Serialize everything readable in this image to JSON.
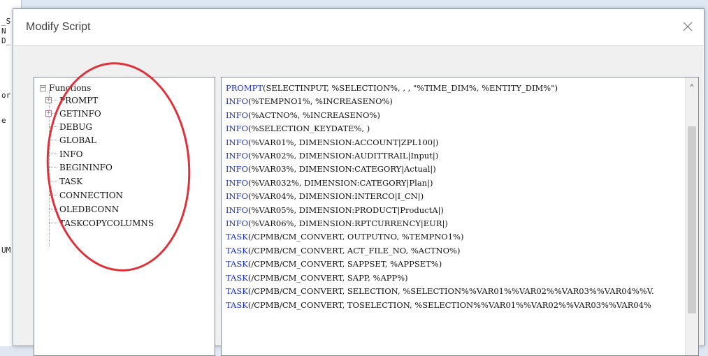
{
  "background": {
    "fragments": [
      "_S",
      "N",
      "D_",
      "or",
      "e",
      "UM"
    ]
  },
  "dialog": {
    "title": "Modify Script",
    "close_glyph": "×"
  },
  "tree": {
    "root_label": "Functions",
    "root_expander": "−",
    "child_expander": "+",
    "items": [
      "PROMPT",
      "GETINFO",
      "DEBUG",
      "GLOBAL",
      "INFO",
      "BEGININFO",
      "TASK",
      "CONNECTION",
      "OLEDBCONN",
      "TASKCOPYCOLUMNS"
    ]
  },
  "script": {
    "lines": [
      {
        "cmd": "PROMPT",
        "args": "(SELECTINPUT, %SELECTION%, , , \"%TIME_DIM%, %ENTITY_DIM%\")"
      },
      {
        "cmd": "INFO",
        "args": "(%TEMPNO1%, %INCREASENO%)"
      },
      {
        "cmd": "INFO",
        "args": "(%ACTNO%, %INCREASENO%)"
      },
      {
        "cmd": "INFO",
        "args": "(%SELECTION_KEYDATE%, )"
      },
      {
        "cmd": "INFO",
        "args": "(%VAR01%, DIMENSION:ACCOUNT|ZPL100|)"
      },
      {
        "cmd": "INFO",
        "args": "(%VAR02%, DIMENSION:AUDITTRAIL|Input|)"
      },
      {
        "cmd": "INFO",
        "args": "(%VAR03%, DIMENSION:CATEGORY|Actual|)"
      },
      {
        "cmd": "INFO",
        "args": "(%VAR032%, DIMENSION:CATEGORY|Plan|)"
      },
      {
        "cmd": "INFO",
        "args": "(%VAR04%, DIMENSION:INTERCO|I_CN|)"
      },
      {
        "cmd": "INFO",
        "args": "(%VAR05%, DIMENSION:PRODUCT|ProductA|)"
      },
      {
        "cmd": "INFO",
        "args": "(%VAR06%, DIMENSION:RPTCURRENCY|EUR|)"
      },
      {
        "cmd": "TASK",
        "args": "(/CPMB/CM_CONVERT, OUTPUTNO, %TEMPNO1%)"
      },
      {
        "cmd": "TASK",
        "args": "(/CPMB/CM_CONVERT, ACT_FILE_NO, %ACTNO%)"
      },
      {
        "cmd": "TASK",
        "args": "(/CPMB/CM_CONVERT, SAPPSET, %APPSET%)"
      },
      {
        "cmd": "TASK",
        "args": "(/CPMB/CM_CONVERT, SAPP, %APP%)"
      },
      {
        "cmd": "TASK",
        "args": "(/CPMB/CM_CONVERT, SELECTION, %SELECTION%%VAR01%%VAR02%%VAR03%%VAR04%%V."
      },
      {
        "cmd": "TASK",
        "args": "(/CPMB/CM_CONVERT, TOSELECTION, %SELECTION%%VAR01%%VAR02%%VAR03%%VAR04%"
      }
    ],
    "scroll_up_glyph": "^"
  },
  "colors": {
    "keyword": "#1a33c8",
    "annotation_circle": "#e0313a"
  }
}
